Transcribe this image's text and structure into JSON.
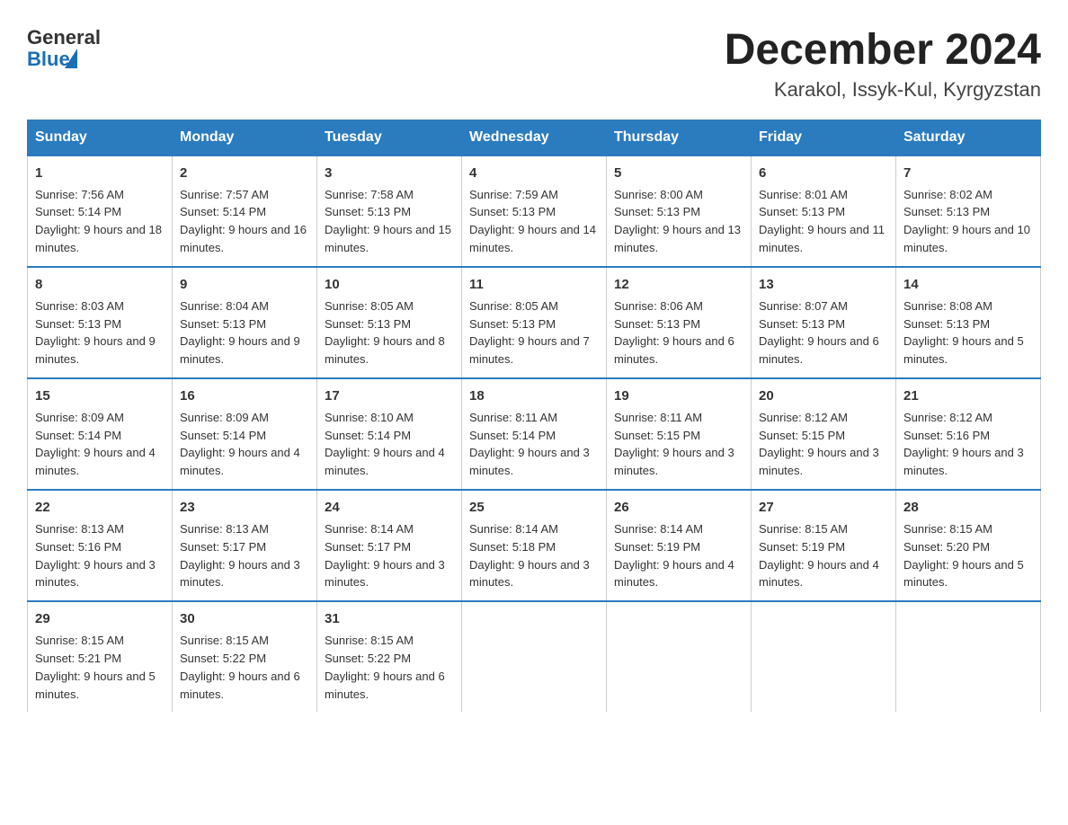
{
  "header": {
    "logo_general": "General",
    "logo_blue": "Blue",
    "title": "December 2024",
    "location": "Karakol, Issyk-Kul, Kyrgyzstan"
  },
  "days_of_week": [
    "Sunday",
    "Monday",
    "Tuesday",
    "Wednesday",
    "Thursday",
    "Friday",
    "Saturday"
  ],
  "weeks": [
    [
      {
        "day": "1",
        "sunrise": "Sunrise: 7:56 AM",
        "sunset": "Sunset: 5:14 PM",
        "daylight": "Daylight: 9 hours and 18 minutes."
      },
      {
        "day": "2",
        "sunrise": "Sunrise: 7:57 AM",
        "sunset": "Sunset: 5:14 PM",
        "daylight": "Daylight: 9 hours and 16 minutes."
      },
      {
        "day": "3",
        "sunrise": "Sunrise: 7:58 AM",
        "sunset": "Sunset: 5:13 PM",
        "daylight": "Daylight: 9 hours and 15 minutes."
      },
      {
        "day": "4",
        "sunrise": "Sunrise: 7:59 AM",
        "sunset": "Sunset: 5:13 PM",
        "daylight": "Daylight: 9 hours and 14 minutes."
      },
      {
        "day": "5",
        "sunrise": "Sunrise: 8:00 AM",
        "sunset": "Sunset: 5:13 PM",
        "daylight": "Daylight: 9 hours and 13 minutes."
      },
      {
        "day": "6",
        "sunrise": "Sunrise: 8:01 AM",
        "sunset": "Sunset: 5:13 PM",
        "daylight": "Daylight: 9 hours and 11 minutes."
      },
      {
        "day": "7",
        "sunrise": "Sunrise: 8:02 AM",
        "sunset": "Sunset: 5:13 PM",
        "daylight": "Daylight: 9 hours and 10 minutes."
      }
    ],
    [
      {
        "day": "8",
        "sunrise": "Sunrise: 8:03 AM",
        "sunset": "Sunset: 5:13 PM",
        "daylight": "Daylight: 9 hours and 9 minutes."
      },
      {
        "day": "9",
        "sunrise": "Sunrise: 8:04 AM",
        "sunset": "Sunset: 5:13 PM",
        "daylight": "Daylight: 9 hours and 9 minutes."
      },
      {
        "day": "10",
        "sunrise": "Sunrise: 8:05 AM",
        "sunset": "Sunset: 5:13 PM",
        "daylight": "Daylight: 9 hours and 8 minutes."
      },
      {
        "day": "11",
        "sunrise": "Sunrise: 8:05 AM",
        "sunset": "Sunset: 5:13 PM",
        "daylight": "Daylight: 9 hours and 7 minutes."
      },
      {
        "day": "12",
        "sunrise": "Sunrise: 8:06 AM",
        "sunset": "Sunset: 5:13 PM",
        "daylight": "Daylight: 9 hours and 6 minutes."
      },
      {
        "day": "13",
        "sunrise": "Sunrise: 8:07 AM",
        "sunset": "Sunset: 5:13 PM",
        "daylight": "Daylight: 9 hours and 6 minutes."
      },
      {
        "day": "14",
        "sunrise": "Sunrise: 8:08 AM",
        "sunset": "Sunset: 5:13 PM",
        "daylight": "Daylight: 9 hours and 5 minutes."
      }
    ],
    [
      {
        "day": "15",
        "sunrise": "Sunrise: 8:09 AM",
        "sunset": "Sunset: 5:14 PM",
        "daylight": "Daylight: 9 hours and 4 minutes."
      },
      {
        "day": "16",
        "sunrise": "Sunrise: 8:09 AM",
        "sunset": "Sunset: 5:14 PM",
        "daylight": "Daylight: 9 hours and 4 minutes."
      },
      {
        "day": "17",
        "sunrise": "Sunrise: 8:10 AM",
        "sunset": "Sunset: 5:14 PM",
        "daylight": "Daylight: 9 hours and 4 minutes."
      },
      {
        "day": "18",
        "sunrise": "Sunrise: 8:11 AM",
        "sunset": "Sunset: 5:14 PM",
        "daylight": "Daylight: 9 hours and 3 minutes."
      },
      {
        "day": "19",
        "sunrise": "Sunrise: 8:11 AM",
        "sunset": "Sunset: 5:15 PM",
        "daylight": "Daylight: 9 hours and 3 minutes."
      },
      {
        "day": "20",
        "sunrise": "Sunrise: 8:12 AM",
        "sunset": "Sunset: 5:15 PM",
        "daylight": "Daylight: 9 hours and 3 minutes."
      },
      {
        "day": "21",
        "sunrise": "Sunrise: 8:12 AM",
        "sunset": "Sunset: 5:16 PM",
        "daylight": "Daylight: 9 hours and 3 minutes."
      }
    ],
    [
      {
        "day": "22",
        "sunrise": "Sunrise: 8:13 AM",
        "sunset": "Sunset: 5:16 PM",
        "daylight": "Daylight: 9 hours and 3 minutes."
      },
      {
        "day": "23",
        "sunrise": "Sunrise: 8:13 AM",
        "sunset": "Sunset: 5:17 PM",
        "daylight": "Daylight: 9 hours and 3 minutes."
      },
      {
        "day": "24",
        "sunrise": "Sunrise: 8:14 AM",
        "sunset": "Sunset: 5:17 PM",
        "daylight": "Daylight: 9 hours and 3 minutes."
      },
      {
        "day": "25",
        "sunrise": "Sunrise: 8:14 AM",
        "sunset": "Sunset: 5:18 PM",
        "daylight": "Daylight: 9 hours and 3 minutes."
      },
      {
        "day": "26",
        "sunrise": "Sunrise: 8:14 AM",
        "sunset": "Sunset: 5:19 PM",
        "daylight": "Daylight: 9 hours and 4 minutes."
      },
      {
        "day": "27",
        "sunrise": "Sunrise: 8:15 AM",
        "sunset": "Sunset: 5:19 PM",
        "daylight": "Daylight: 9 hours and 4 minutes."
      },
      {
        "day": "28",
        "sunrise": "Sunrise: 8:15 AM",
        "sunset": "Sunset: 5:20 PM",
        "daylight": "Daylight: 9 hours and 5 minutes."
      }
    ],
    [
      {
        "day": "29",
        "sunrise": "Sunrise: 8:15 AM",
        "sunset": "Sunset: 5:21 PM",
        "daylight": "Daylight: 9 hours and 5 minutes."
      },
      {
        "day": "30",
        "sunrise": "Sunrise: 8:15 AM",
        "sunset": "Sunset: 5:22 PM",
        "daylight": "Daylight: 9 hours and 6 minutes."
      },
      {
        "day": "31",
        "sunrise": "Sunrise: 8:15 AM",
        "sunset": "Sunset: 5:22 PM",
        "daylight": "Daylight: 9 hours and 6 minutes."
      },
      {
        "day": "",
        "sunrise": "",
        "sunset": "",
        "daylight": ""
      },
      {
        "day": "",
        "sunrise": "",
        "sunset": "",
        "daylight": ""
      },
      {
        "day": "",
        "sunrise": "",
        "sunset": "",
        "daylight": ""
      },
      {
        "day": "",
        "sunrise": "",
        "sunset": "",
        "daylight": ""
      }
    ]
  ]
}
